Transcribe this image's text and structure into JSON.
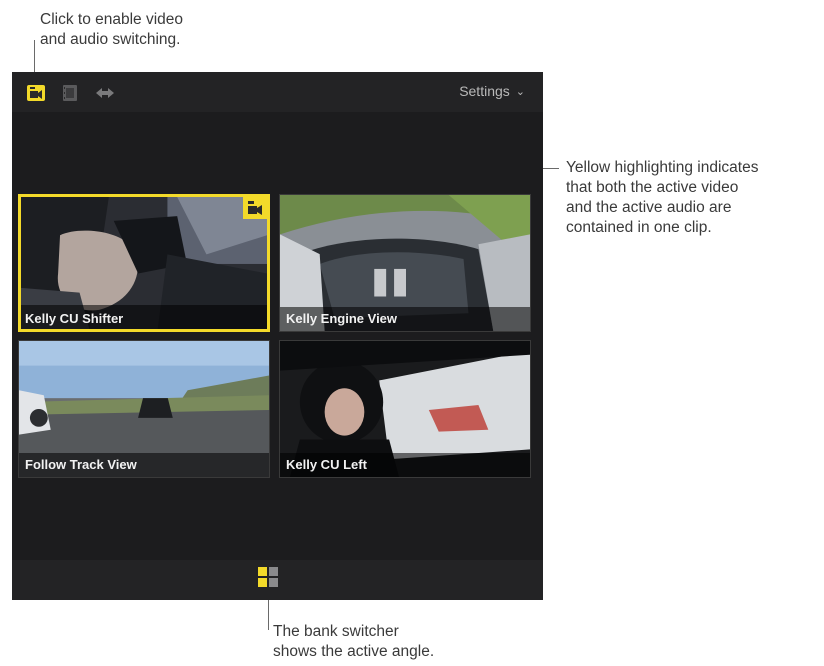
{
  "callouts": {
    "top": [
      "Click to enable video",
      "and audio switching."
    ],
    "right": [
      "Yellow highlighting indicates",
      "that both the active video",
      "and the active audio are",
      "contained in one clip."
    ],
    "bottom": [
      "The bank switcher",
      "shows the active angle."
    ]
  },
  "toolbar": {
    "settings_label": "Settings",
    "settings_chevron": "⌄",
    "icons": [
      "video-audio-switch-icon",
      "video-only-switch-icon",
      "audio-only-switch-icon"
    ]
  },
  "angles": [
    {
      "label": "Kelly CU Shifter",
      "active": true
    },
    {
      "label": "Kelly Engine View",
      "active": false
    },
    {
      "label": "Follow Track View",
      "active": false
    },
    {
      "label": "Kelly CU Left",
      "active": false
    }
  ],
  "colors": {
    "highlight": "#f3da2a",
    "panel": "#1c1c1e",
    "toolbar": "#232325"
  }
}
